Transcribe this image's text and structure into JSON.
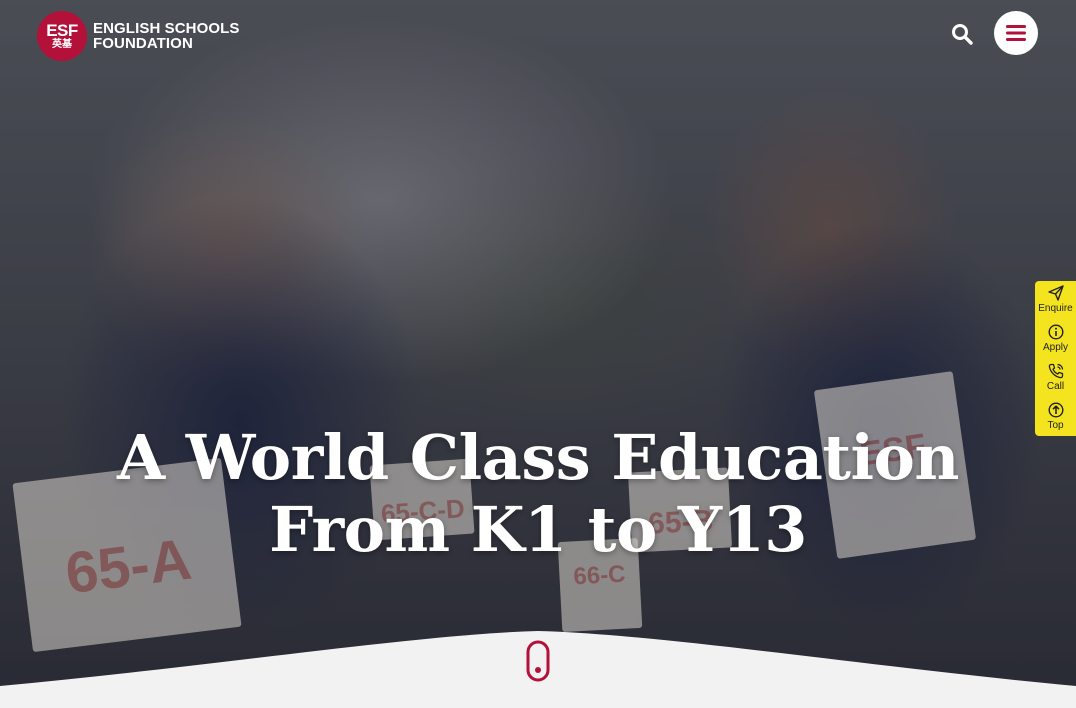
{
  "header": {
    "logo": {
      "badge_line1": "ESF",
      "badge_line2": "英基",
      "name_line1": "ENGLISH SCHOOLS",
      "name_line2": "FOUNDATION"
    },
    "search_icon": "search-icon",
    "menu_icon": "hamburger-menu-icon"
  },
  "hero": {
    "headline_line1": "A World Class Education",
    "headline_line2": "From K1 to Y13",
    "bibs": [
      "65-A",
      "65-C-D",
      "65-B",
      "66-C",
      "ESF"
    ]
  },
  "side_toolbar": {
    "items": [
      {
        "label": "Enquire",
        "icon": "paper-plane-icon"
      },
      {
        "label": "Apply",
        "icon": "info-circle-icon"
      },
      {
        "label": "Call",
        "icon": "phone-icon"
      },
      {
        "label": "Top",
        "icon": "arrow-up-circle-icon"
      }
    ]
  },
  "colors": {
    "brand": "#b3103a",
    "toolbar": "#f4e31f",
    "footer_bg": "#f2f2f2"
  }
}
